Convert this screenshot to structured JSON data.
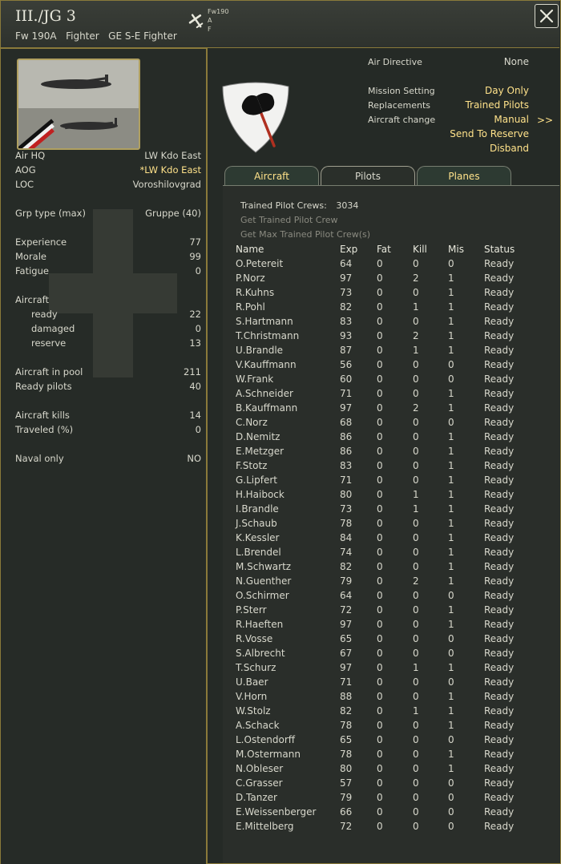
{
  "header": {
    "title": "III./JG 3",
    "subtitle": "Fw 190A   Fighter   GE S-E Fighter",
    "aircraft_code": [
      "Fw190",
      "A",
      "F"
    ]
  },
  "left": {
    "air_hq_label": "Air HQ",
    "air_hq": "LW Kdo East",
    "aog_label": "AOG",
    "aog": "*LW Kdo East",
    "loc_label": "LOC",
    "loc": "Voroshilovgrad",
    "grp_label": "Grp type (max)",
    "grp": "Gruppe (40)",
    "experience_label": "Experience",
    "experience": "77",
    "morale_label": "Morale",
    "morale": "99",
    "fatigue_label": "Fatigue",
    "fatigue": "0",
    "aircraft_label": "Aircraft",
    "ready_label": "ready",
    "ready": "22",
    "damaged_label": "damaged",
    "damaged": "0",
    "reserve_label": "reserve",
    "reserve": "13",
    "pool_label": "Aircraft in pool",
    "pool": "211",
    "ready_pilots_label": "Ready pilots",
    "ready_pilots": "40",
    "kills_label": "Aircraft kills",
    "kills": "14",
    "traveled_label": "Traveled (%)",
    "traveled": "0",
    "naval_label": "Naval only",
    "naval": "NO"
  },
  "right": {
    "air_directive_label": "Air Directive",
    "air_directive": "None",
    "mission_label": "Mission Setting",
    "mission": "Day Only",
    "replacements_label": "Replacements",
    "replacements": "Trained Pilots",
    "aircraft_change_label": "Aircraft change",
    "aircraft_change": "Manual",
    "arrows": ">>",
    "send_reserve": "Send To Reserve",
    "disband": "Disband"
  },
  "tabs": [
    "Aircraft",
    "Pilots",
    "Planes"
  ],
  "crew": {
    "trained_label": "Trained Pilot Crews:",
    "trained_value": "3034",
    "get_one": "Get Trained Pilot Crew",
    "get_max": "Get Max Trained Pilot Crew(s)"
  },
  "pilot_table": {
    "headers": [
      "Name",
      "Exp",
      "Fat",
      "Kill",
      "Mis",
      "Status"
    ],
    "rows": [
      [
        "O.Petereit",
        "64",
        "0",
        "0",
        "0",
        "Ready"
      ],
      [
        "P.Norz",
        "97",
        "0",
        "2",
        "1",
        "Ready"
      ],
      [
        "R.Kuhns",
        "73",
        "0",
        "0",
        "1",
        "Ready"
      ],
      [
        "R.Pohl",
        "82",
        "0",
        "1",
        "1",
        "Ready"
      ],
      [
        "S.Hartmann",
        "83",
        "0",
        "0",
        "1",
        "Ready"
      ],
      [
        "T.Christmann",
        "93",
        "0",
        "2",
        "1",
        "Ready"
      ],
      [
        "U.Brandle",
        "87",
        "0",
        "1",
        "1",
        "Ready"
      ],
      [
        "V.Kauffmann",
        "56",
        "0",
        "0",
        "0",
        "Ready"
      ],
      [
        "W.Frank",
        "60",
        "0",
        "0",
        "0",
        "Ready"
      ],
      [
        "A.Schneider",
        "71",
        "0",
        "0",
        "1",
        "Ready"
      ],
      [
        "B.Kauffmann",
        "97",
        "0",
        "2",
        "1",
        "Ready"
      ],
      [
        "C.Norz",
        "68",
        "0",
        "0",
        "0",
        "Ready"
      ],
      [
        "D.Nemitz",
        "86",
        "0",
        "0",
        "1",
        "Ready"
      ],
      [
        "E.Metzger",
        "86",
        "0",
        "0",
        "1",
        "Ready"
      ],
      [
        "F.Stotz",
        "83",
        "0",
        "0",
        "1",
        "Ready"
      ],
      [
        "G.Lipfert",
        "71",
        "0",
        "0",
        "1",
        "Ready"
      ],
      [
        "H.Haibock",
        "80",
        "0",
        "1",
        "1",
        "Ready"
      ],
      [
        "I.Brandle",
        "73",
        "0",
        "1",
        "1",
        "Ready"
      ],
      [
        "J.Schaub",
        "78",
        "0",
        "0",
        "1",
        "Ready"
      ],
      [
        "K.Kessler",
        "84",
        "0",
        "0",
        "1",
        "Ready"
      ],
      [
        "L.Brendel",
        "74",
        "0",
        "0",
        "1",
        "Ready"
      ],
      [
        "M.Schwartz",
        "82",
        "0",
        "0",
        "1",
        "Ready"
      ],
      [
        "N.Guenther",
        "79",
        "0",
        "2",
        "1",
        "Ready"
      ],
      [
        "O.Schirmer",
        "64",
        "0",
        "0",
        "0",
        "Ready"
      ],
      [
        "P.Sterr",
        "72",
        "0",
        "0",
        "1",
        "Ready"
      ],
      [
        "R.Haeften",
        "97",
        "0",
        "0",
        "1",
        "Ready"
      ],
      [
        "R.Vosse",
        "65",
        "0",
        "0",
        "0",
        "Ready"
      ],
      [
        "S.Albrecht",
        "67",
        "0",
        "0",
        "0",
        "Ready"
      ],
      [
        "T.Schurz",
        "97",
        "0",
        "1",
        "1",
        "Ready"
      ],
      [
        "U.Baer",
        "71",
        "0",
        "0",
        "0",
        "Ready"
      ],
      [
        "V.Horn",
        "88",
        "0",
        "0",
        "1",
        "Ready"
      ],
      [
        "W.Stolz",
        "82",
        "0",
        "1",
        "1",
        "Ready"
      ],
      [
        "A.Schack",
        "78",
        "0",
        "0",
        "1",
        "Ready"
      ],
      [
        "L.Ostendorff",
        "65",
        "0",
        "0",
        "0",
        "Ready"
      ],
      [
        "M.Ostermann",
        "78",
        "0",
        "0",
        "1",
        "Ready"
      ],
      [
        "N.Obleser",
        "80",
        "0",
        "0",
        "1",
        "Ready"
      ],
      [
        "C.Grasser",
        "57",
        "0",
        "0",
        "0",
        "Ready"
      ],
      [
        "D.Tanzer",
        "79",
        "0",
        "0",
        "0",
        "Ready"
      ],
      [
        "E.Weissenberger",
        "66",
        "0",
        "0",
        "0",
        "Ready"
      ],
      [
        "E.Mittelberg",
        "72",
        "0",
        "0",
        "0",
        "Ready"
      ]
    ]
  },
  "colors": {
    "accent": "#ffe28a",
    "border": "#8a7a3a",
    "background": "#252a26"
  },
  "icons": [
    "aircraft-icon",
    "close-icon",
    "unit-emblem-icon",
    "unit-photo"
  ]
}
